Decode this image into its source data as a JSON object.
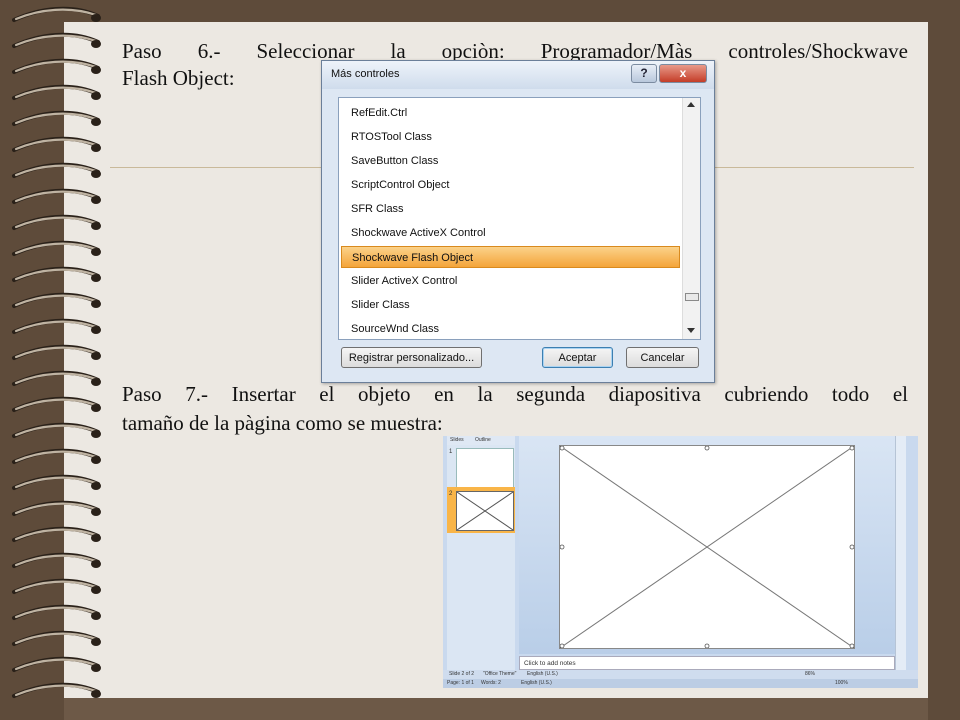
{
  "doc": {
    "paso6_line1": "Paso 6.- Seleccionar la opciòn: Programador/Màs controles/Shockwave",
    "paso6_line2": "Flash Object:",
    "paso7_line1": "Paso 7.- Insertar el objeto en la segunda diapositiva cubriendo todo el",
    "paso7_line2": "tamaño de la pàgina como se muestra:"
  },
  "dialog": {
    "title": "Más controles",
    "help_label": "?",
    "close_label": "x",
    "items": [
      "RefEdit.Ctrl",
      "RTOSTool Class",
      "SaveButton Class",
      "ScriptControl Object",
      "SFR Class",
      "Shockwave ActiveX Control",
      "Shockwave Flash Object",
      "Slider ActiveX Control",
      "Slider Class",
      "SourceWnd Class"
    ],
    "selected_item": "Shockwave Flash Object",
    "register_button": "Registrar personalizado...",
    "ok_button": "Aceptar",
    "cancel_button": "Cancelar"
  },
  "ppt": {
    "tab_slides": "Slides",
    "tab_outline": "Outline",
    "slide1_num": "1",
    "slide2_num": "2",
    "notes_placeholder": "Click to add notes",
    "status_slide": "Slide 2 of 2",
    "status_theme": "\"Office Theme\"",
    "status_lang": "English (U.S.)",
    "status_zoom": "86%",
    "status_page": "Page: 1 of 1",
    "status_words": "Words: 2",
    "status_lang2": "English (U.S.)",
    "status_zoom2": "100%"
  },
  "colors": {
    "page_bg": "#ece8e2",
    "selection_orange": "#f4a43a",
    "frame_brown": "#5e4b3a"
  }
}
